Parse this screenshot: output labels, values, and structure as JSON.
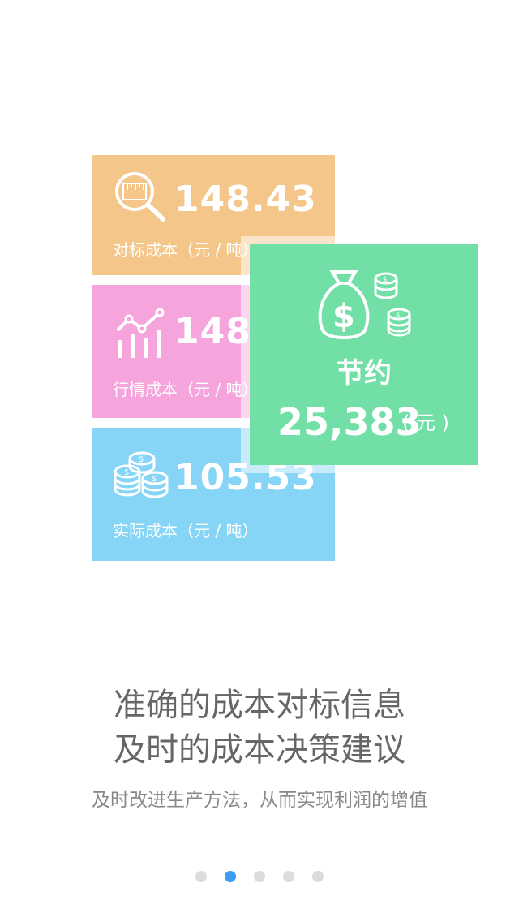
{
  "cards": {
    "benchmark": {
      "value": "148.43",
      "label": "对标成本（元 / 吨）",
      "icon": "ruler-magnifier-icon",
      "color": "#f5c68a"
    },
    "market": {
      "value": "148.43",
      "label": "行情成本（元 / 吨）",
      "icon": "trend-chart-icon",
      "color": "#f5a4dc"
    },
    "actual": {
      "value": "105.53",
      "label": "实际成本（元 / 吨）",
      "icon": "coins-icon",
      "color": "#86d5f7"
    }
  },
  "savings": {
    "title": "节约",
    "amount": "25,383",
    "unit": "( 元 )",
    "icon": "money-bag-icon",
    "color": "#71dfa6"
  },
  "headline": {
    "line1": "准确的成本对标信息",
    "line2": "及时的成本决策建议"
  },
  "subtitle": "及时改进生产方法，从而实现利润的增值",
  "pager": {
    "count": 5,
    "active_index": 1,
    "active_color": "#3d9bf0",
    "inactive_color": "#dcdcdc"
  }
}
